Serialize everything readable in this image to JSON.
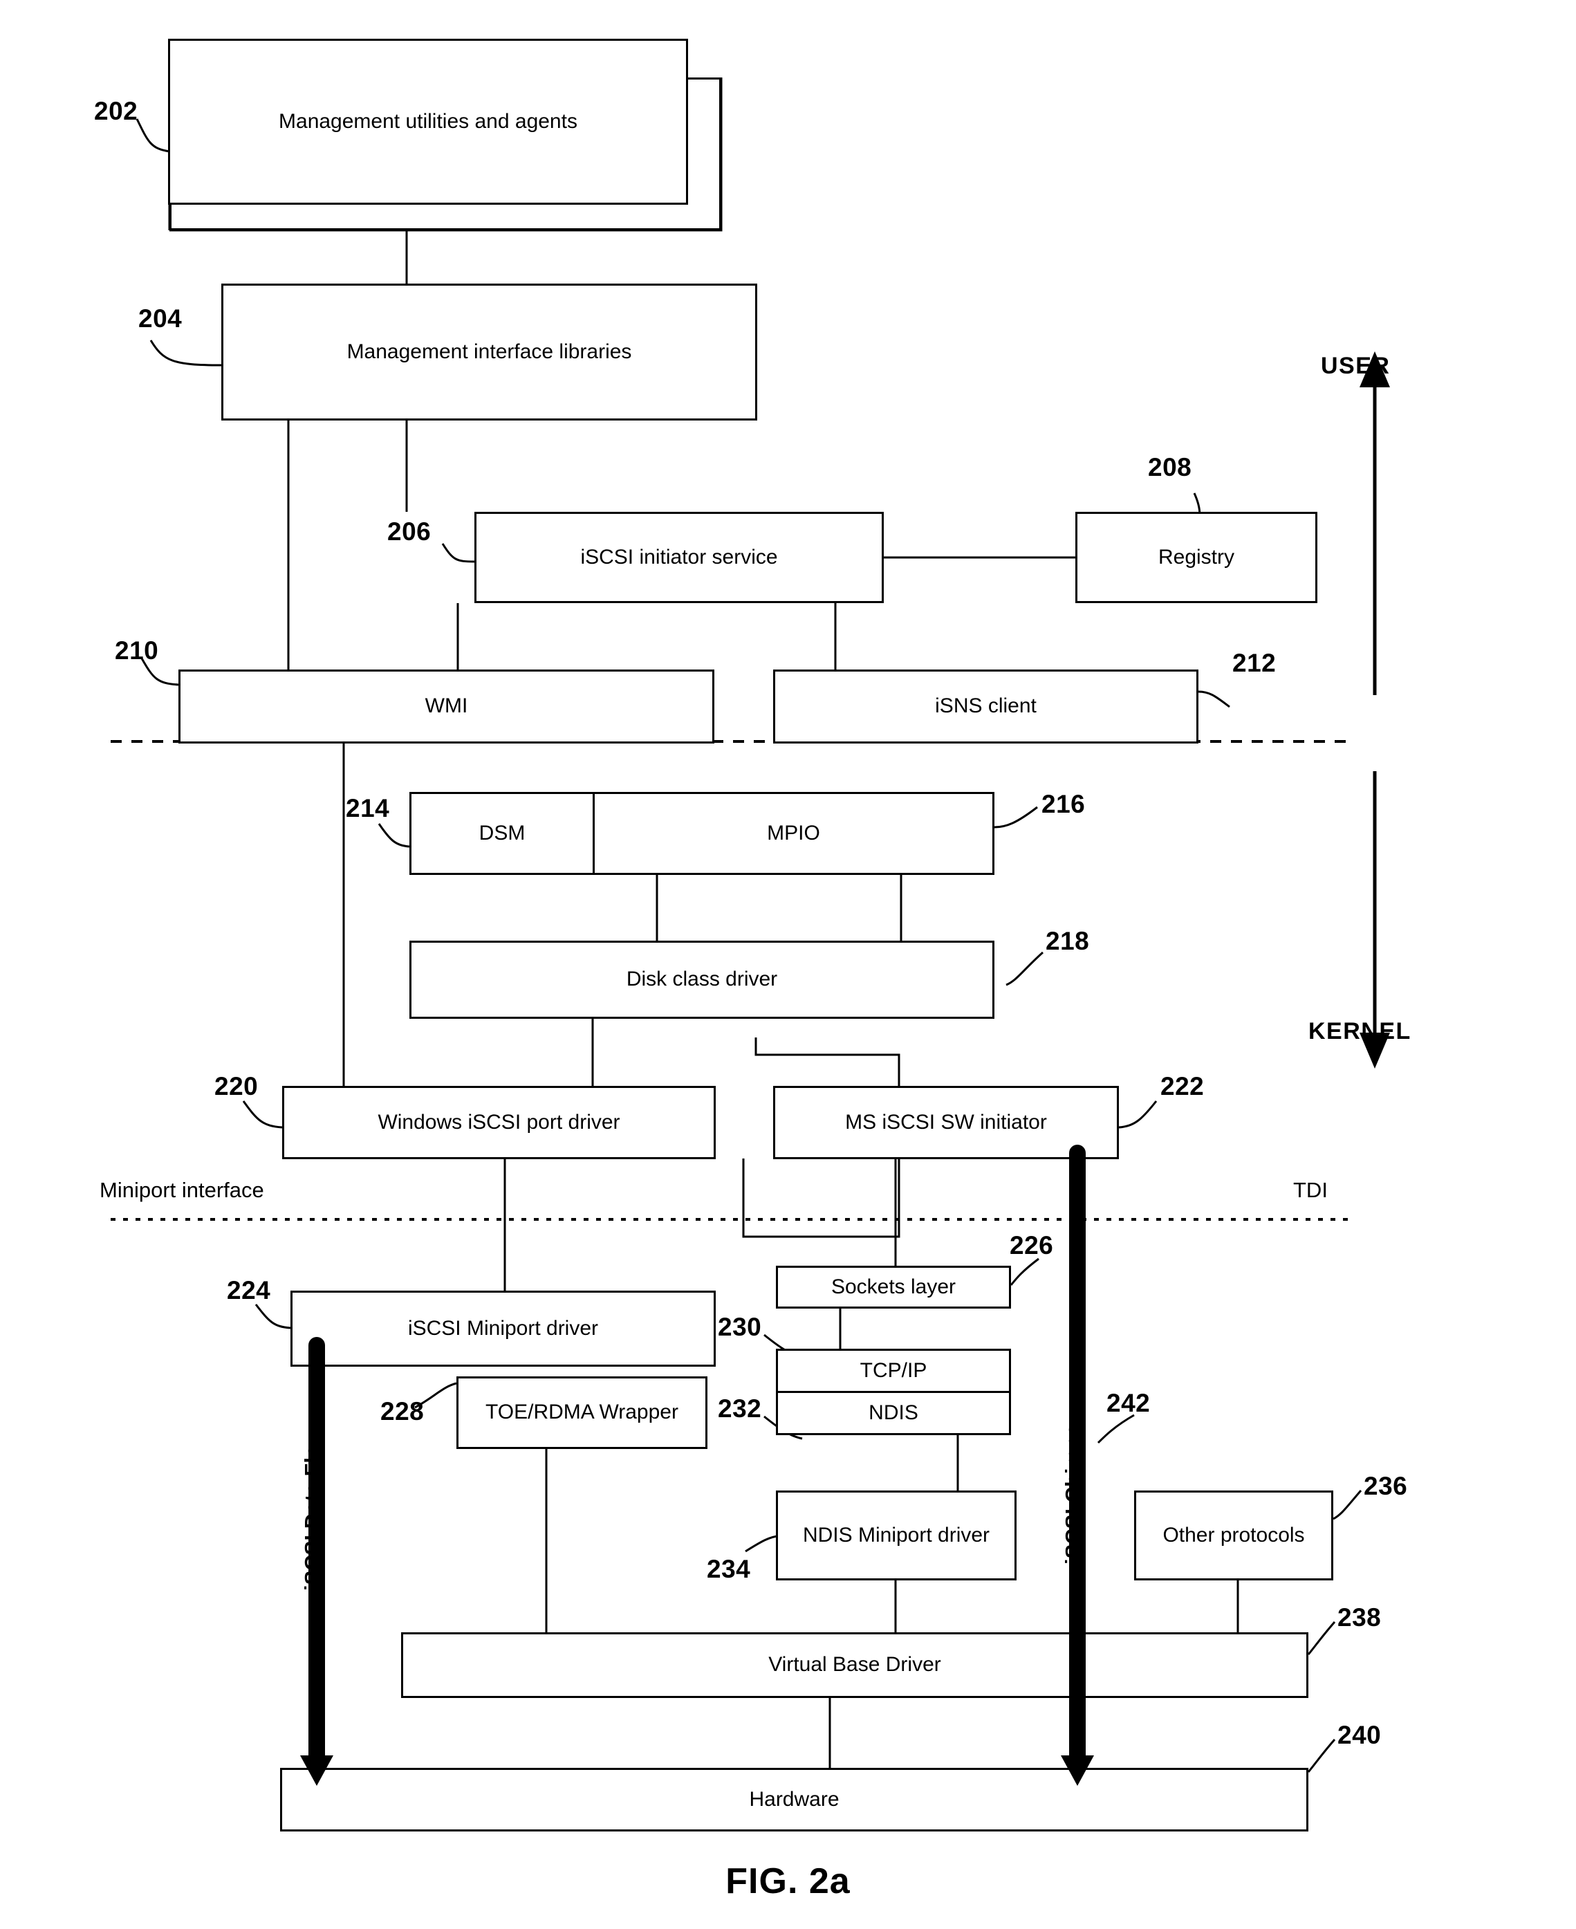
{
  "figure": {
    "caption": "FIG. 2a",
    "domain_regions": {
      "user": "USER",
      "kernel": "KERNEL"
    },
    "interface_labels": {
      "miniport": "Miniport interface",
      "tdi": "TDI"
    },
    "flow_labels": {
      "data_flow": "iSCSI Data Flow",
      "chimney": "iSCSI Chimney"
    }
  },
  "blocks": {
    "mgmt_utilities": {
      "label": "Management utilities and agents",
      "ref": "202"
    },
    "mgmt_libraries": {
      "label": "Management interface libraries",
      "ref": "204"
    },
    "initiator_service": {
      "label": "iSCSI initiator service",
      "ref": "206"
    },
    "registry": {
      "label": "Registry",
      "ref": "208"
    },
    "wmi": {
      "label": "WMI",
      "ref": "210"
    },
    "isns_client": {
      "label": "iSNS client",
      "ref": "212"
    },
    "dsm": {
      "label": "DSM",
      "ref": "214"
    },
    "mpio": {
      "label": "MPIO",
      "ref": "216"
    },
    "disk_class_driver": {
      "label": "Disk class driver",
      "ref": "218"
    },
    "port_driver": {
      "label": "Windows iSCSI port driver",
      "ref": "220"
    },
    "sw_initiator": {
      "label": "MS iSCSI SW initiator",
      "ref": "222"
    },
    "iscsi_miniport": {
      "label": "iSCSI Miniport driver",
      "ref": "224"
    },
    "sockets_layer": {
      "label": "Sockets layer",
      "ref": "226"
    },
    "toe_rdma_wrapper": {
      "label": "TOE/RDMA Wrapper",
      "ref": "228"
    },
    "tcpip": {
      "label": "TCP/IP",
      "ref": "230"
    },
    "ndis": {
      "label": "NDIS",
      "ref": "232"
    },
    "ndis_miniport": {
      "label": "NDIS Miniport driver",
      "ref": "234"
    },
    "other_protocols": {
      "label": "Other protocols",
      "ref": "236"
    },
    "virtual_base": {
      "label": "Virtual Base Driver",
      "ref": "238"
    },
    "hardware": {
      "label": "Hardware",
      "ref": "240"
    },
    "chimney_bar": {
      "label": "iSCSI Chimney",
      "ref": "242"
    }
  }
}
